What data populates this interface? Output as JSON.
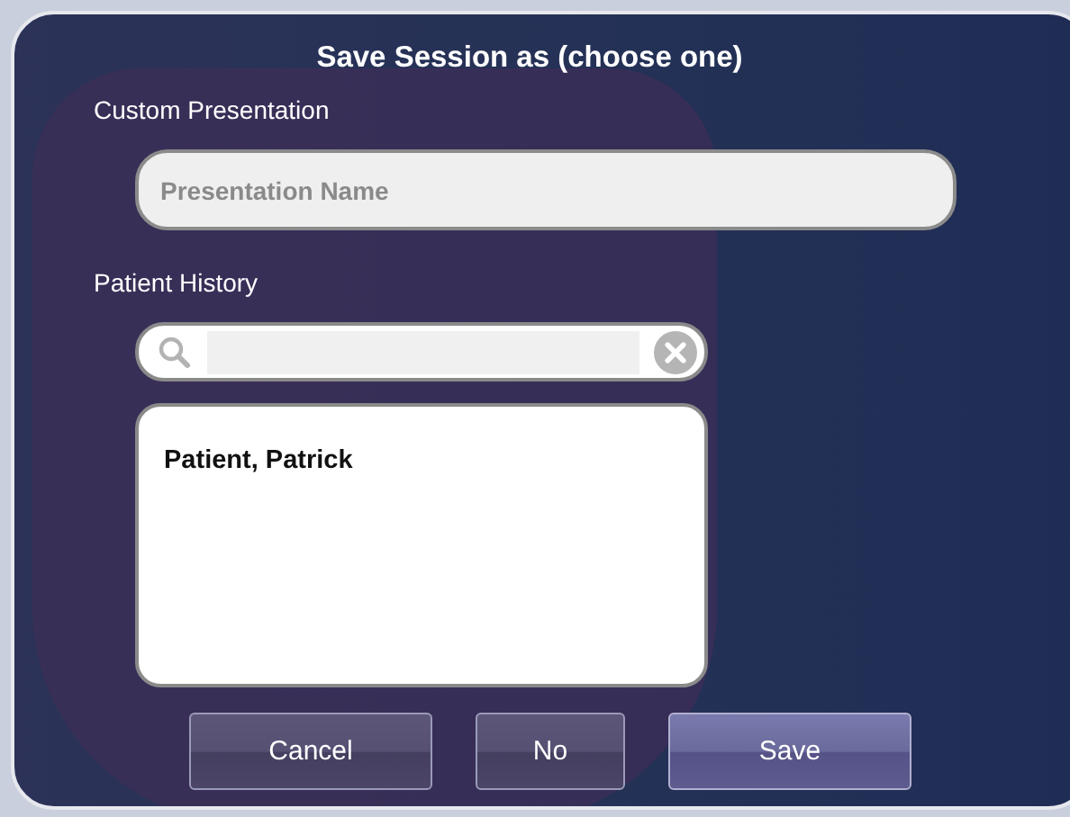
{
  "dialog": {
    "title": "Save Session as (choose one)"
  },
  "custom_presentation": {
    "label": "Custom Presentation",
    "placeholder": "Presentation Name"
  },
  "patient_history": {
    "label": "Patient History",
    "items": [
      {
        "name": "Patient, Patrick",
        "selected": false
      }
    ]
  },
  "buttons": [
    {
      "label": "Cancel",
      "default": false
    },
    {
      "label": "No",
      "default": false
    },
    {
      "label": "Save",
      "default": true
    }
  ]
}
